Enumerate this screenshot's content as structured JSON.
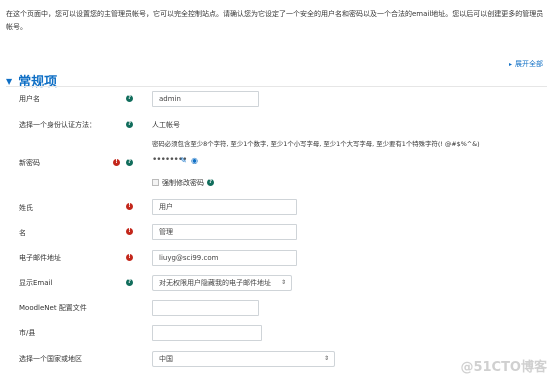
{
  "intro": "在这个页面中，您可以设置您的主管理员帐号，它可以完全控制站点。请确认您为它设定了一个安全的用户名和密码以及一个合法的email地址。您以后可以创建更多的管理员帐号。",
  "expand_all": "展开全部",
  "section_title": "常规项",
  "fields": {
    "username": {
      "label": "用户名",
      "value": "admin"
    },
    "auth": {
      "label": "选择一个身份认证方法：",
      "value": "人工帐号"
    },
    "password_rule": "密码必须包含至少8个字符, 至少1个数字, 至少1个小写字母, 至少1个大写字母, 至少要有1个特殊字符(! @#$%^&)",
    "new_password": {
      "label": "新密码",
      "value": "••••••••"
    },
    "force_change": "强制修改密码",
    "lastname": {
      "label": "姓氏",
      "value": "用户"
    },
    "firstname": {
      "label": "名",
      "value": "管理"
    },
    "email": {
      "label": "电子邮件地址",
      "value": "liuyg@sci99.com"
    },
    "display_email": {
      "label": "显示Email",
      "value": "对无权限用户隐藏我的电子邮件地址"
    },
    "moodlenet": {
      "label": "MoodleNet 配置文件",
      "value": ""
    },
    "city": {
      "label": "市/县",
      "value": ""
    },
    "country": {
      "label": "选择一个国家或地区",
      "value": "中国"
    }
  },
  "icons": {
    "help": "question-icon",
    "required": "exclamation-icon",
    "help_color": "#116d5c",
    "required_color": "#c3271b",
    "accent": "#0f6fc5"
  },
  "watermark": "@51CTO博客"
}
